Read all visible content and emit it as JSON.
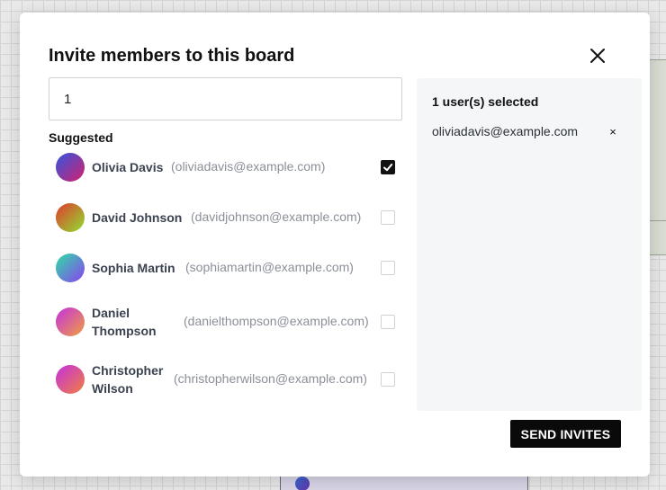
{
  "modal": {
    "title": "Invite members to this board",
    "search_value": "1",
    "suggested_label": "Suggested",
    "send_label": "SEND INVITES"
  },
  "users": [
    {
      "name_lines": [
        "Olivia Davis"
      ],
      "email": "(oliviadavis@example.com)",
      "checked": true,
      "gradient": [
        "#2f56e0",
        "#d6206e"
      ]
    },
    {
      "name_lines": [
        "David Johnson"
      ],
      "email": "(davidjohnson@example.com)",
      "checked": false,
      "gradient": [
        "#e0392f",
        "#8fe02f"
      ]
    },
    {
      "name_lines": [
        "Sophia Martin"
      ],
      "email": "(sophiamartin@example.com)",
      "checked": false,
      "gradient": [
        "#2fe0a6",
        "#8a3ff0"
      ]
    },
    {
      "name_lines": [
        "Daniel",
        "Thompson"
      ],
      "email": "(danielthompson@example.com)",
      "checked": false,
      "gradient": [
        "#c42fe0",
        "#f0a03f"
      ]
    },
    {
      "name_lines": [
        "Christopher",
        "Wilson"
      ],
      "email": "(christopherwilson@example.com)",
      "checked": false,
      "gradient": [
        "#c42fe0",
        "#f0803f"
      ]
    }
  ],
  "selected": {
    "count_label": "1 user(s) selected",
    "items": [
      {
        "email": "oliviadavis@example.com",
        "remove_glyph": "×"
      }
    ]
  }
}
